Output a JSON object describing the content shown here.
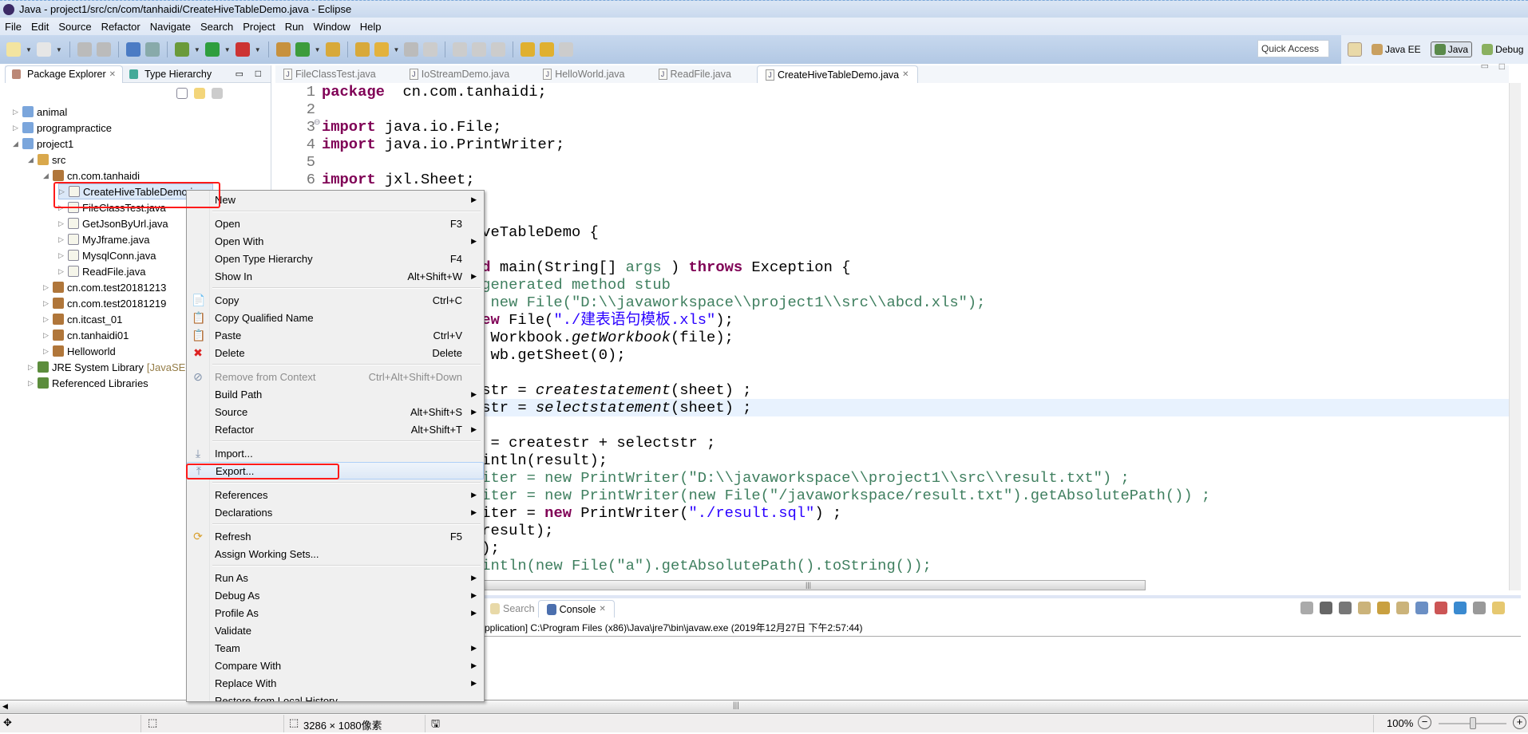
{
  "window": {
    "title": "Java - project1/src/cn/com/tanhaidi/CreateHiveTableDemo.java - Eclipse"
  },
  "menubar": [
    "File",
    "Edit",
    "Source",
    "Refactor",
    "Navigate",
    "Search",
    "Project",
    "Run",
    "Window",
    "Help"
  ],
  "toolbar": {
    "icons": [
      "new-icon",
      "new-dropdown",
      "save-icon",
      "save-all-icon",
      "terminal-icon",
      "skip-breakpoints-icon",
      "debug-icon",
      "run-icon",
      "external-tools-icon",
      "new-java-package-icon",
      "new-java-class-icon",
      "open-type-icon",
      "open-task-icon",
      "search-icon",
      "toggle-mark-icon",
      "toggle-block-icon",
      "show-whitespace-icon",
      "next-annotation-icon",
      "previous-annotation-icon",
      "last-edit-icon",
      "back-icon",
      "forward-icon"
    ],
    "quick_access": "Quick Access",
    "perspectives": [
      {
        "label": "Java EE",
        "selected": false
      },
      {
        "label": "Java",
        "selected": true
      },
      {
        "label": "Debug",
        "selected": false
      }
    ]
  },
  "left_panel": {
    "tabs": [
      {
        "label": "Package Explorer",
        "active": true
      },
      {
        "label": "Type Hierarchy",
        "active": false
      }
    ],
    "tree": [
      {
        "label": "animal",
        "depth": 0,
        "expanded": false,
        "icon": "project-icon"
      },
      {
        "label": "programpractice",
        "depth": 0,
        "expanded": false,
        "icon": "project-icon"
      },
      {
        "label": "project1",
        "depth": 0,
        "expanded": true,
        "icon": "project-icon"
      },
      {
        "label": "src",
        "depth": 1,
        "expanded": true,
        "icon": "source-folder-icon"
      },
      {
        "label": "cn.com.tanhaidi",
        "depth": 2,
        "expanded": true,
        "icon": "package-icon"
      },
      {
        "label": "CreateHiveTableDemo.java",
        "depth": 3,
        "expanded": false,
        "icon": "java-file-icon",
        "selected": true
      },
      {
        "label": "FileClassTest.java",
        "depth": 3,
        "expanded": false,
        "icon": "java-file-icon"
      },
      {
        "label": "GetJsonByUrl.java",
        "depth": 3,
        "expanded": false,
        "icon": "java-file-icon"
      },
      {
        "label": "MyJframe.java",
        "depth": 3,
        "expanded": false,
        "icon": "java-file-icon"
      },
      {
        "label": "MysqlConn.java",
        "depth": 3,
        "expanded": false,
        "icon": "java-file-icon"
      },
      {
        "label": "ReadFile.java",
        "depth": 3,
        "expanded": false,
        "icon": "java-file-icon"
      },
      {
        "label": "cn.com.test20181213",
        "depth": 2,
        "expanded": false,
        "icon": "package-icon"
      },
      {
        "label": "cn.com.test20181219",
        "depth": 2,
        "expanded": false,
        "icon": "package-icon"
      },
      {
        "label": "cn.itcast_01",
        "depth": 2,
        "expanded": false,
        "icon": "package-icon"
      },
      {
        "label": "cn.tanhaidi01",
        "depth": 2,
        "expanded": false,
        "icon": "package-icon"
      },
      {
        "label": "Helloworld",
        "depth": 2,
        "expanded": false,
        "icon": "package-icon"
      },
      {
        "label": "JRE System Library",
        "suffix": "[JavaSE-",
        "depth": 1,
        "expanded": false,
        "icon": "library-icon"
      },
      {
        "label": "Referenced Libraries",
        "depth": 1,
        "expanded": false,
        "icon": "library-icon"
      }
    ]
  },
  "editor": {
    "tabs": [
      {
        "label": "FileClassTest.java",
        "active": false
      },
      {
        "label": "IoStreamDemo.java",
        "active": false
      },
      {
        "label": "HelloWorld.java",
        "active": false
      },
      {
        "label": "ReadFile.java",
        "active": false
      },
      {
        "label": "CreateHiveTableDemo.java",
        "active": true
      }
    ],
    "lines": [
      {
        "n": "1",
        "seg": [
          [
            "kw",
            "package"
          ],
          [
            "",
            "  cn.com.tanhaidi;"
          ]
        ]
      },
      {
        "n": "2",
        "seg": []
      },
      {
        "n": "3",
        "seg": [
          [
            "kw",
            "import"
          ],
          [
            "",
            " java.io.File;"
          ]
        ]
      },
      {
        "n": "4",
        "seg": [
          [
            "kw",
            "import"
          ],
          [
            "",
            " java.io.PrintWriter;"
          ]
        ]
      },
      {
        "n": "5",
        "seg": []
      },
      {
        "n": "6",
        "seg": [
          [
            "kw",
            "import"
          ],
          [
            "",
            " jxl.Sheet;"
          ]
        ]
      },
      {
        "seg": []
      },
      {
        "seg": []
      },
      {
        "seg": [
          [
            "",
            "iveTableDemo {"
          ]
        ]
      },
      {
        "seg": []
      },
      {
        "seg": [
          [
            "kw",
            "id"
          ],
          [
            "",
            " main(String[] "
          ],
          [
            "cm",
            "args"
          ],
          [
            "",
            " ) "
          ],
          [
            "kw",
            "throws"
          ],
          [
            "",
            " Exception {"
          ]
        ]
      },
      {
        "seg": [
          [
            "cm",
            "-generated method stub"
          ]
        ]
      },
      {
        "seg": [
          [
            "cm",
            "= new File(\"D:\\\\javaworkspace\\\\project1\\\\src\\\\abcd.xls\");"
          ]
        ]
      },
      {
        "seg": [
          [
            "kw",
            "new"
          ],
          [
            "",
            " File("
          ],
          [
            "st",
            "\"./建表语句模板.xls\""
          ],
          [
            "",
            ");"
          ]
        ]
      },
      {
        "seg": [
          [
            "",
            "= Workbook."
          ],
          [
            "it",
            "getWorkbook"
          ],
          [
            "",
            "(file);"
          ]
        ]
      },
      {
        "seg": [
          [
            "",
            "= wb.getSheet(0);"
          ]
        ]
      },
      {
        "seg": []
      },
      {
        "seg": [
          [
            "",
            "estr = "
          ],
          [
            "it",
            "createstatement"
          ],
          [
            "",
            "(sheet) ;"
          ]
        ]
      },
      {
        "seg": [
          [
            "",
            "tstr = "
          ],
          [
            "it",
            "selectstatement"
          ],
          [
            "",
            "(sheet) ;"
          ]
        ],
        "current": true
      },
      {
        "seg": []
      },
      {
        "seg": [
          [
            "",
            "t = createstr + selectstr ;"
          ]
        ]
      },
      {
        "seg": [
          [
            "",
            "rintln(result);"
          ]
        ]
      },
      {
        "seg": [
          [
            "cm",
            "riter = new PrintWriter(\"D:\\\\javaworkspace\\\\project1\\\\src\\\\result.txt\") ;"
          ]
        ]
      },
      {
        "seg": [
          [
            "cm",
            "riter = new PrintWriter(new File(\"/javaworkspace/result.txt\").getAbsolutePath()) ;"
          ]
        ]
      },
      {
        "seg": [
          [
            "",
            "riter = "
          ],
          [
            "kw",
            "new"
          ],
          [
            "",
            " PrintWriter("
          ],
          [
            "st",
            "\"./result.sql\""
          ],
          [
            "",
            ") ;"
          ]
        ]
      },
      {
        "seg": [
          [
            "",
            "(result);"
          ]
        ]
      },
      {
        "seg": [
          [
            "",
            "();"
          ]
        ]
      },
      {
        "seg": [
          [
            "cm",
            "rintln(new File(\"a\").getAbsolutePath().toString());"
          ]
        ]
      }
    ]
  },
  "console": {
    "tabs": [
      {
        "label": "Search",
        "active": false
      },
      {
        "label": "Console",
        "active": true
      }
    ],
    "description": "pplication] C:\\Program Files (x86)\\Java\\jre7\\bin\\javaw.exe (2019年12月27日 下午2:57:44)",
    "toolbar_icons": [
      "terminate-icon",
      "remove-launch-icon",
      "remove-all-icon",
      "clear-console-icon",
      "scroll-lock-icon",
      "word-wrap-icon",
      "show-on-stdout-icon",
      "show-on-stderr-icon",
      "pin-console-icon",
      "display-console-icon",
      "open-console-icon"
    ]
  },
  "context_menu": {
    "groups": [
      [
        {
          "label": "New",
          "submenu": true
        }
      ],
      [
        {
          "label": "Open",
          "shortcut": "F3"
        },
        {
          "label": "Open With",
          "submenu": true
        },
        {
          "label": "Open Type Hierarchy",
          "shortcut": "F4"
        },
        {
          "label": "Show In",
          "shortcut": "Alt+Shift+W",
          "submenu": true
        }
      ],
      [
        {
          "label": "Copy",
          "shortcut": "Ctrl+C",
          "icon": "copy-icon"
        },
        {
          "label": "Copy Qualified Name",
          "icon": "copy-qualified-icon"
        },
        {
          "label": "Paste",
          "shortcut": "Ctrl+V",
          "icon": "paste-icon"
        },
        {
          "label": "Delete",
          "shortcut": "Delete",
          "icon": "delete-icon"
        }
      ],
      [
        {
          "label": "Remove from Context",
          "shortcut": "Ctrl+Alt+Shift+Down",
          "disabled": true,
          "icon": "remove-context-icon"
        },
        {
          "label": "Build Path",
          "submenu": true
        },
        {
          "label": "Source",
          "shortcut": "Alt+Shift+S",
          "submenu": true
        },
        {
          "label": "Refactor",
          "shortcut": "Alt+Shift+T",
          "submenu": true
        }
      ],
      [
        {
          "label": "Import...",
          "icon": "import-icon"
        },
        {
          "label": "Export...",
          "icon": "export-icon",
          "highlighted": true
        }
      ],
      [
        {
          "label": "References",
          "submenu": true
        },
        {
          "label": "Declarations",
          "submenu": true
        }
      ],
      [
        {
          "label": "Refresh",
          "shortcut": "F5",
          "icon": "refresh-icon"
        },
        {
          "label": "Assign Working Sets..."
        }
      ],
      [
        {
          "label": "Run As",
          "submenu": true
        },
        {
          "label": "Debug As",
          "submenu": true
        },
        {
          "label": "Profile As",
          "submenu": true
        },
        {
          "label": "Validate"
        },
        {
          "label": "Team",
          "submenu": true
        },
        {
          "label": "Compare With",
          "submenu": true
        },
        {
          "label": "Replace With",
          "submenu": true
        },
        {
          "label": "Restore from Local History..."
        }
      ]
    ]
  },
  "statusbar": {
    "dimensions": "3286 × 1080像素",
    "zoom": "100%",
    "zoom_level_percent": 100
  },
  "colors": {
    "annotation_red": "#ff1a1a",
    "keyword": "#7f0055",
    "string": "#2a00ff",
    "comment": "#3f7f5f",
    "current_line": "#e8f2fe"
  }
}
